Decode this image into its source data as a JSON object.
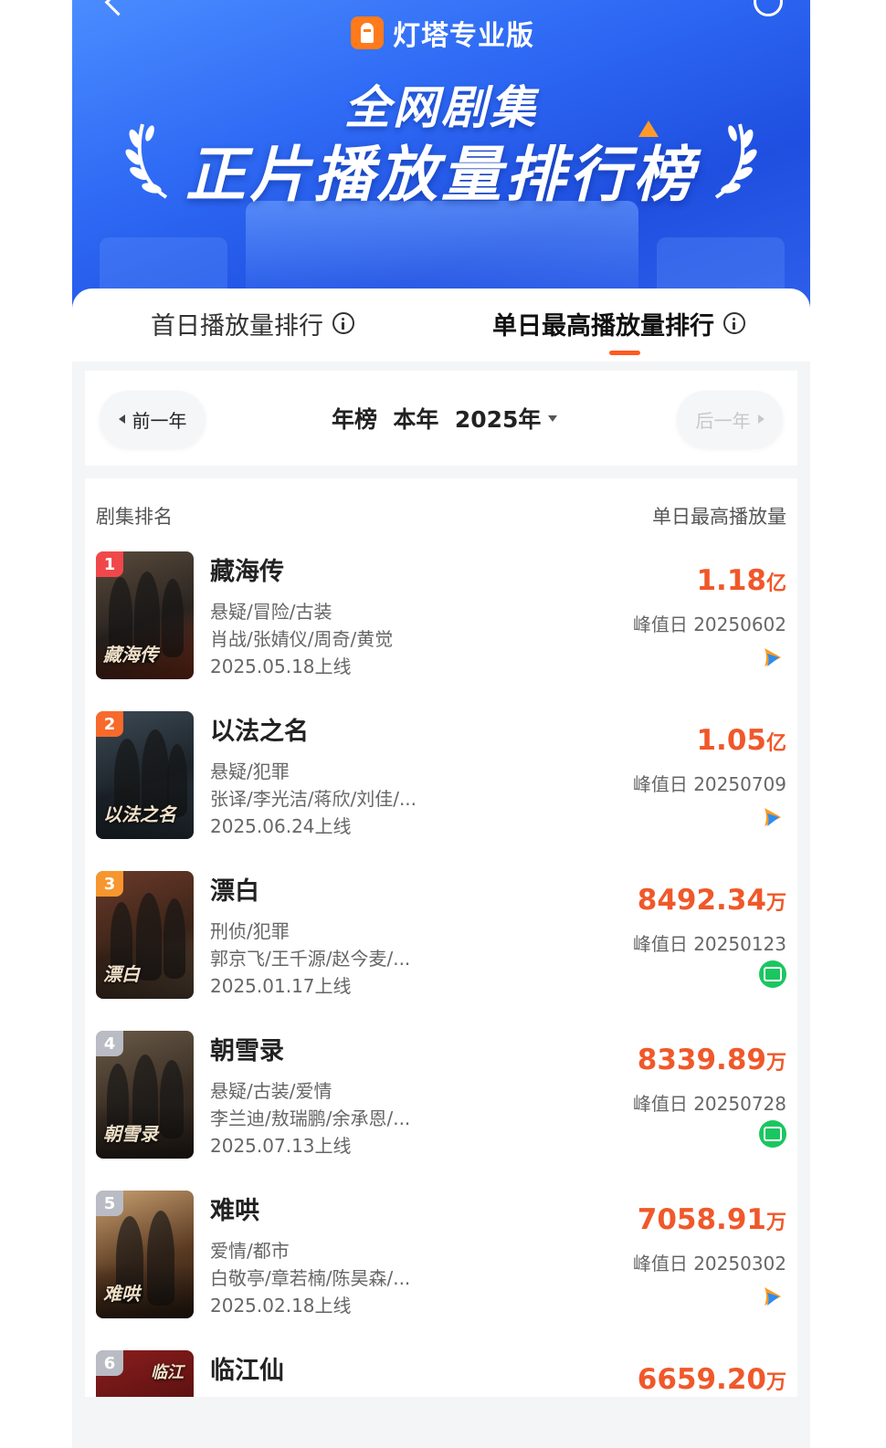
{
  "app": {
    "brand_name": "灯塔专业版"
  },
  "banner": {
    "title_line1": "全网剧集",
    "title_line2": "正片播放量排行榜"
  },
  "tabs": [
    {
      "label": "首日播放量排行",
      "active": false
    },
    {
      "label": "单日最高播放量排行",
      "active": true
    }
  ],
  "year_selector": {
    "prev_label": "前一年",
    "current_label": "年榜  本年  2025年",
    "next_label": "后一年"
  },
  "list": {
    "header_left": "剧集排名",
    "header_right": "单日最高播放量",
    "rows": [
      {
        "rank": "1",
        "title": "藏海传",
        "genre": "悬疑/冒险/古装",
        "cast": "肖战/张婧仪/周奇/黄觉",
        "date": "2025.05.18上线",
        "value": "1.18",
        "unit": "亿",
        "peak": "峰值日 20250602",
        "platform": "tencent-video-icon",
        "poster_text": "藏海传"
      },
      {
        "rank": "2",
        "title": "以法之名",
        "genre": "悬疑/犯罪",
        "cast": "张译/李光洁/蒋欣/刘佳/...",
        "date": "2025.06.24上线",
        "value": "1.05",
        "unit": "亿",
        "peak": "峰值日 20250709",
        "platform": "tencent-video-icon",
        "poster_text": "以法之名"
      },
      {
        "rank": "3",
        "title": "漂白",
        "genre": "刑侦/犯罪",
        "cast": "郭京飞/王千源/赵今麦/...",
        "date": "2025.01.17上线",
        "value": "8492.34",
        "unit": "万",
        "peak": "峰值日 20250123",
        "platform": "iqiyi-icon",
        "poster_text": "漂白"
      },
      {
        "rank": "4",
        "title": "朝雪录",
        "genre": "悬疑/古装/爱情",
        "cast": "李兰迪/敖瑞鹏/余承恩/...",
        "date": "2025.07.13上线",
        "value": "8339.89",
        "unit": "万",
        "peak": "峰值日 20250728",
        "platform": "iqiyi-icon",
        "poster_text": "朝雪录"
      },
      {
        "rank": "5",
        "title": "难哄",
        "genre": "爱情/都市",
        "cast": "白敬亭/章若楠/陈昊森/...",
        "date": "2025.02.18上线",
        "value": "7058.91",
        "unit": "万",
        "peak": "峰值日 20250302",
        "platform": "tencent-video-icon",
        "poster_text": "难哄"
      },
      {
        "rank": "6",
        "title": "临江仙",
        "genre": "",
        "cast": "",
        "date": "",
        "value": "6659.20",
        "unit": "万",
        "peak": "",
        "platform": "",
        "poster_text": "临江"
      }
    ]
  },
  "colors": {
    "accent": "#f0582a",
    "banner_blue": "#2f6bf5",
    "rank1": "#f0484a",
    "rank2": "#f66a2c",
    "rank3": "#f7962e",
    "rank_other": "#b9bcc4",
    "iqiyi_green": "#1bc660"
  }
}
